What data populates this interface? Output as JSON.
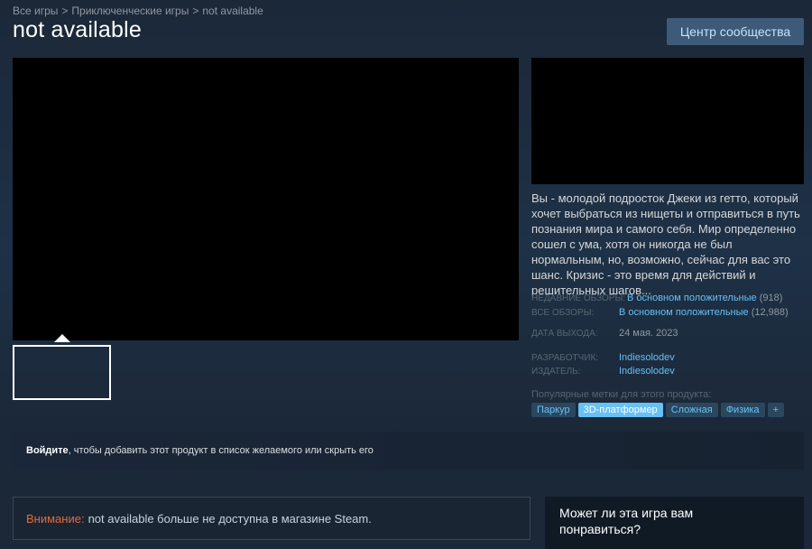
{
  "breadcrumb": {
    "items": [
      "Все игры",
      "Приключенческие игры",
      "not available"
    ],
    "separator": ">"
  },
  "title": "not available",
  "community_button": "Центр сообщества",
  "description": "Вы - молодой подросток Джеки из гетто, который хочет выбраться из нищеты и отправиться в путь познания мира и самого себя. Мир определенно сошел с ума, хотя он никогда не был нормальным, но, возможно, сейчас для вас это шанс. Кризис - это время для действий и решительных шагов...",
  "reviews": {
    "recent_label": "НЕДАВНИЕ ОБЗОРЫ:",
    "recent_value": "В основном положительные",
    "recent_count": "(918)",
    "all_label": "ВСЕ ОБЗОРЫ:",
    "all_value": "В основном положительные",
    "all_count": "(12,988)"
  },
  "release": {
    "label": "ДАТА ВЫХОДА:",
    "value": "24 мая. 2023"
  },
  "developer": {
    "label": "РАЗРАБОТЧИК:",
    "value": "Indiesolodev"
  },
  "publisher": {
    "label": "ИЗДАТЕЛЬ:",
    "value": "Indiesolodev"
  },
  "tags": {
    "label": "Популярные метки для этого продукта:",
    "items": [
      "Паркур",
      "3D-платформер",
      "Сложная",
      "Физика",
      "+"
    ]
  },
  "wishlist": {
    "login": "Войдите",
    "text": ", чтобы добавить этот продукт в список желаемого или скрыть его"
  },
  "notice": {
    "warning": "Внимание:",
    "text": "not available больше не доступна в магазине Steam."
  },
  "recommend": {
    "title": "Может ли эта игра вам понравиться?"
  },
  "colors": {
    "background": "#1b2838",
    "link": "#66c0f4",
    "tag_active": "#67c1f5",
    "warning": "#e36b3a"
  }
}
